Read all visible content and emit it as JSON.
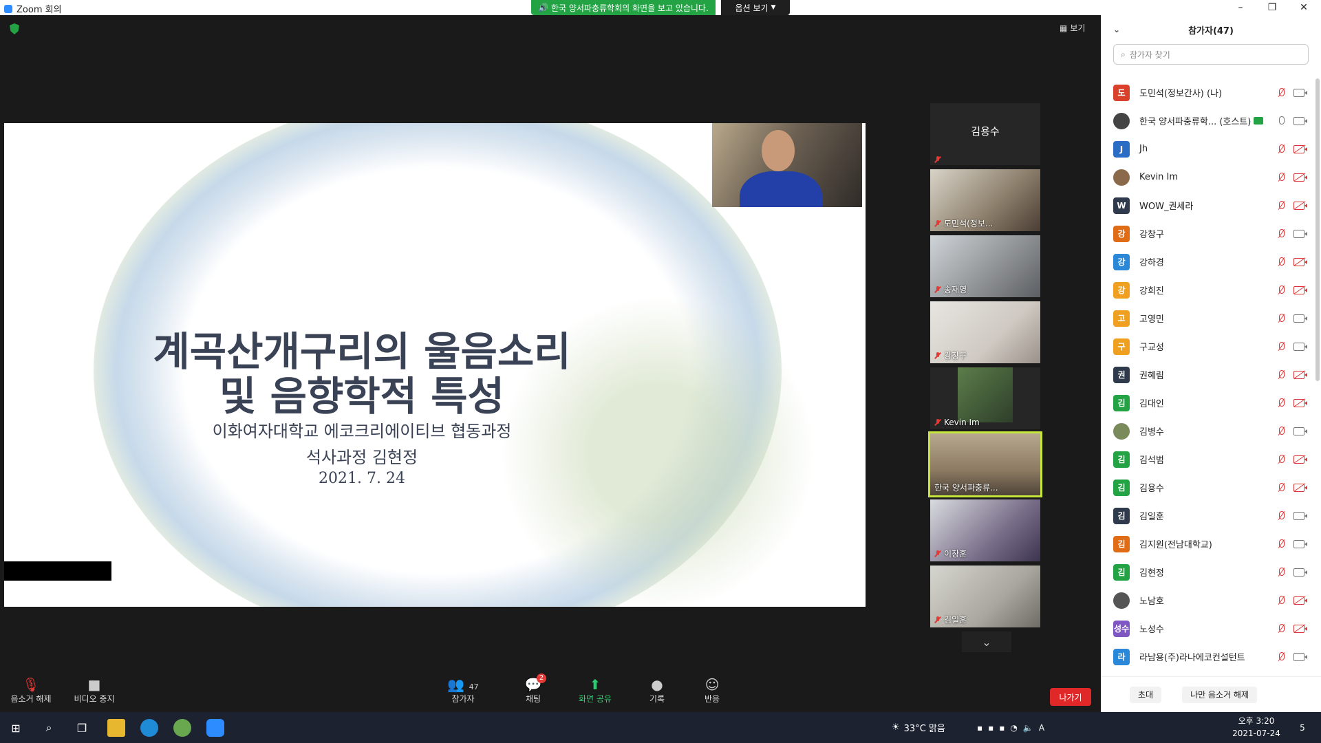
{
  "window": {
    "title": "Zoom 회의",
    "share_banner": "한국 양서파충류학회의 화면을 보고 있습니다.",
    "options_label": "옵션 보기",
    "minimize": "–",
    "maximize": "❐",
    "close": "✕"
  },
  "meeting": {
    "view_label": "보기"
  },
  "slide": {
    "title_line1": "계곡산개구리의 울음소리",
    "title_line2": "및 음향학적 특성",
    "sub1": "이화여자대학교 에코크리에이티브 협동과정",
    "sub2": "석사과정 김현정",
    "date": "2021. 7. 24"
  },
  "gallery": {
    "tiles": [
      {
        "name": "김용수"
      },
      {
        "name": "도민석(정보..."
      },
      {
        "name": "송재영"
      },
      {
        "name": "강창구"
      },
      {
        "name": "Kevin Im"
      },
      {
        "name": "한국 양서파충류..."
      },
      {
        "name": "이창훈"
      },
      {
        "name": "김일훈"
      }
    ],
    "scroll_icon": "chevron-down-icon",
    "scroll_glyph": "⌄"
  },
  "toolbar": {
    "mute_label": "음소거 해제",
    "video_label": "비디오 중지",
    "participants_label": "참가자",
    "participants_count": "47",
    "chat_label": "채팅",
    "chat_badge": "2",
    "share_label": "화면 공유",
    "record_label": "기록",
    "reactions_label": "반응",
    "leave_label": "나가기"
  },
  "panel": {
    "title": "참가자(47)",
    "search_placeholder": "참가자 찾기",
    "invite_label": "초대",
    "unmute_me_label": "나만 음소거 해제",
    "participants": [
      {
        "avatar": "도",
        "name": "도민석(정보간사) (나)",
        "color": "#d9412c",
        "mic": "off",
        "cam": "on"
      },
      {
        "avatar": "",
        "name": "한국 양서파충류학... (호스트)",
        "color": "#444444",
        "mic": "on",
        "cam": "on",
        "host": true
      },
      {
        "avatar": "J",
        "name": "Jh",
        "color": "#2b6cc4",
        "mic": "off",
        "cam": "off"
      },
      {
        "avatar": "",
        "name": "Kevin Im",
        "color": "#8a6a4a",
        "mic": "off",
        "cam": "off"
      },
      {
        "avatar": "W",
        "name": "WOW_권세라",
        "color": "#2f3b4c",
        "mic": "off",
        "cam": "off"
      },
      {
        "avatar": "강",
        "name": "강창구",
        "color": "#e06c16",
        "mic": "off",
        "cam": "on"
      },
      {
        "avatar": "강",
        "name": "강하경",
        "color": "#2b88d8",
        "mic": "off",
        "cam": "off"
      },
      {
        "avatar": "강",
        "name": "강희진",
        "color": "#f0a020",
        "mic": "off",
        "cam": "off"
      },
      {
        "avatar": "고",
        "name": "고영민",
        "color": "#f0a020",
        "mic": "off",
        "cam": "on"
      },
      {
        "avatar": "구",
        "name": "구교성",
        "color": "#f0a020",
        "mic": "off",
        "cam": "on"
      },
      {
        "avatar": "권",
        "name": "권혜림",
        "color": "#2f3b4c",
        "mic": "off",
        "cam": "off"
      },
      {
        "avatar": "김",
        "name": "김대인",
        "color": "#23a344",
        "mic": "off",
        "cam": "off"
      },
      {
        "avatar": "",
        "name": "김병수",
        "color": "#7a8a5a",
        "mic": "off",
        "cam": "on"
      },
      {
        "avatar": "김",
        "name": "김석범",
        "color": "#23a344",
        "mic": "off",
        "cam": "off"
      },
      {
        "avatar": "김",
        "name": "김용수",
        "color": "#23a344",
        "mic": "off",
        "cam": "off"
      },
      {
        "avatar": "김",
        "name": "김일훈",
        "color": "#2f3b4c",
        "mic": "off",
        "cam": "on"
      },
      {
        "avatar": "김",
        "name": "김지원(전남대학교)",
        "color": "#e06c16",
        "mic": "off",
        "cam": "on"
      },
      {
        "avatar": "김",
        "name": "김현정",
        "color": "#23a344",
        "mic": "off",
        "cam": "on"
      },
      {
        "avatar": "",
        "name": "노남호",
        "color": "#555555",
        "mic": "off",
        "cam": "off"
      },
      {
        "avatar": "성수",
        "name": "노성수",
        "color": "#7e57c2",
        "mic": "off",
        "cam": "off"
      },
      {
        "avatar": "라",
        "name": "라남용(주)라나에코컨설턴트",
        "color": "#2b88d8",
        "mic": "off",
        "cam": "on"
      }
    ]
  },
  "taskbar": {
    "weather": "33°C 맑음",
    "time": "오후 3:20",
    "date": "2021-07-24",
    "ime": "A",
    "notif_count": "5"
  }
}
